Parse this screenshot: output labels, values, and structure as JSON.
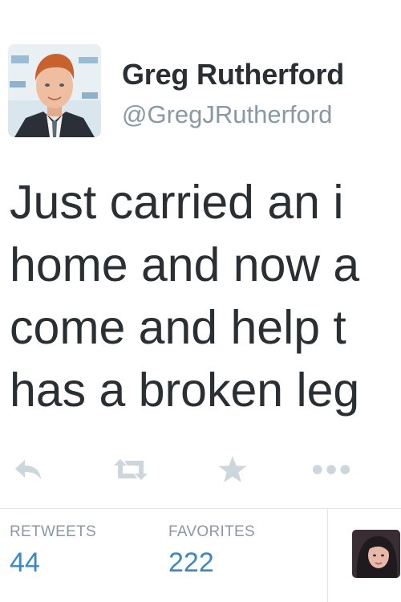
{
  "user": {
    "display_name": "Greg Rutherford",
    "screen_name": "@GregJRutherford"
  },
  "tweet": {
    "lines": [
      "Just carried an i",
      "home and now a",
      "come and help t",
      "has a broken leg"
    ]
  },
  "actions": {
    "icons": [
      "reply-icon",
      "retweet-icon",
      "favorite-icon",
      "more-icon"
    ]
  },
  "stats": {
    "retweets_label": "RETWEETS",
    "retweets_count": "44",
    "favorites_label": "FAVORITES",
    "favorites_count": "222"
  },
  "colors": {
    "text": "#292f33",
    "muted": "#8899a6",
    "count": "#3b88c3",
    "icon": "#ccd6dd",
    "divider": "#e1e8ed"
  }
}
